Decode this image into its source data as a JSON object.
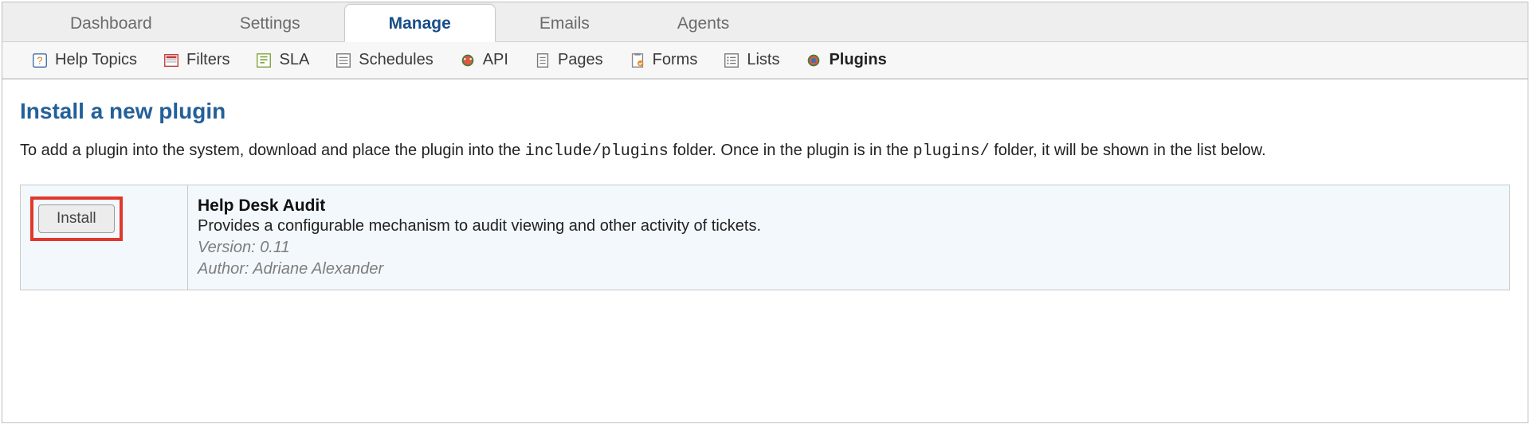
{
  "tabs": {
    "dashboard": "Dashboard",
    "settings": "Settings",
    "manage": "Manage",
    "emails": "Emails",
    "agents": "Agents"
  },
  "subnav": {
    "help_topics": "Help Topics",
    "filters": "Filters",
    "sla": "SLA",
    "schedules": "Schedules",
    "api": "API",
    "pages": "Pages",
    "forms": "Forms",
    "lists": "Lists",
    "plugins": "Plugins"
  },
  "page": {
    "title": "Install a new plugin",
    "intro_prefix": "To add a plugin into the system, download and place the plugin into the ",
    "intro_code1": "include/plugins",
    "intro_mid": " folder. Once in the plugin is in the ",
    "intro_code2": "plugins/",
    "intro_suffix": " folder, it will be shown in the list below."
  },
  "plugin": {
    "install_label": "Install",
    "name": "Help Desk Audit",
    "description": "Provides a configurable mechanism to audit viewing and other activity of tickets.",
    "version_label": "Version: ",
    "version": "0.11",
    "author_label": "Author: ",
    "author": "Adriane Alexander"
  }
}
